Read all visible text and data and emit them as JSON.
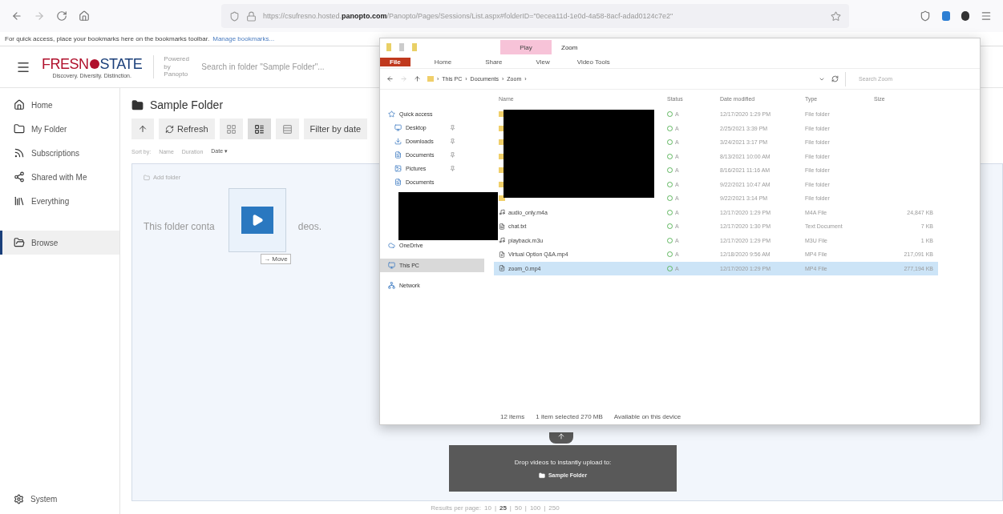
{
  "browser": {
    "url_prefix": "https://csufresno.hosted.",
    "url_domain": "panopto.com",
    "url_path": "/Panopto/Pages/Sessions/List.aspx#folderID=\"0ecea11d-1e0d-4a58-8acf-adad0124c7e2\"",
    "bookmarks_hint": "For quick access, place your bookmarks here on the bookmarks toolbar.",
    "bookmarks_link": "Manage bookmarks..."
  },
  "header": {
    "logo_left": "FRESN",
    "logo_right": "STATE",
    "tagline": "Discovery. Diversity. Distinction.",
    "powered_by": "Powered by Panopto",
    "search_placeholder": "Search in folder \"Sample Folder\"..."
  },
  "sidebar": {
    "items": [
      {
        "label": "Home",
        "kind": "home",
        "selected": false
      },
      {
        "label": "My Folder",
        "kind": "myfolder",
        "selected": false
      },
      {
        "label": "Subscriptions",
        "kind": "subscriptions",
        "selected": false
      },
      {
        "label": "Shared with Me",
        "kind": "shared",
        "selected": false
      },
      {
        "label": "Everything",
        "kind": "everything",
        "selected": false
      },
      {
        "label": "Browse",
        "kind": "browse",
        "selected": true
      }
    ],
    "system": "System"
  },
  "main": {
    "title": "Sample Folder",
    "refresh": "Refresh",
    "views": [
      {
        "kind": "tiles",
        "selected": false
      },
      {
        "kind": "details",
        "selected": true
      },
      {
        "kind": "list",
        "selected": false
      }
    ],
    "filter": "Filter by date",
    "sort_label": "Sort by:",
    "sort_options": [
      {
        "label": "Name",
        "selected": false
      },
      {
        "label": "Duration",
        "selected": false
      },
      {
        "label": "Date ▾",
        "selected": true
      }
    ],
    "add_folder": "Add folder",
    "empty_start": "This folder conta",
    "empty_end": "deos.",
    "drag_label": "→ Move"
  },
  "explorer": {
    "title": "Zoom",
    "context_tab": "Play",
    "context_group": "Video Tools",
    "tabs": [
      {
        "label": "File",
        "kind": "file",
        "selected": true
      },
      {
        "label": "Home",
        "kind": "plain",
        "selected": false
      },
      {
        "label": "Share",
        "kind": "plain",
        "selected": false
      },
      {
        "label": "View",
        "kind": "plain",
        "selected": false
      }
    ],
    "breadcrumb": [
      "This PC",
      "Documents",
      "Zoom"
    ],
    "breadcrumb_separator": "›",
    "search_placeholder": "Search Zoom",
    "nav": [
      {
        "label": "Quick access",
        "kind": "star",
        "pinned": false,
        "selected": false
      },
      {
        "label": "Desktop",
        "kind": "desktop",
        "pinned": true,
        "selected": false
      },
      {
        "label": "Downloads",
        "kind": "download",
        "pinned": true,
        "selected": false
      },
      {
        "label": "Documents",
        "kind": "docs",
        "pinned": true,
        "selected": false
      },
      {
        "label": "Pictures",
        "kind": "pictures",
        "pinned": true,
        "selected": false
      },
      {
        "label": "Documents",
        "kind": "docs",
        "pinned": false,
        "selected": false
      },
      {
        "label": "OneDrive",
        "kind": "cloud",
        "pinned": false,
        "selected": false
      },
      {
        "label": "This PC",
        "kind": "pc",
        "pinned": false,
        "selected": true
      },
      {
        "label": "Network",
        "kind": "network",
        "pinned": false,
        "selected": false
      }
    ],
    "columns": [
      "Name",
      "Status",
      "Date modified",
      "Type",
      "Size"
    ],
    "rows": [
      {
        "kind": "folder",
        "status": "A",
        "date": "12/17/2020 1:29 PM",
        "type": "File folder",
        "selected": false
      },
      {
        "kind": "folder",
        "status": "A",
        "date": "2/25/2021 3:39 PM",
        "type": "File folder",
        "selected": false
      },
      {
        "kind": "folder",
        "status": "A",
        "date": "3/24/2021 3:17 PM",
        "type": "File folder",
        "selected": false
      },
      {
        "kind": "folder",
        "status": "A",
        "date": "8/13/2021 10:00 AM",
        "type": "File folder",
        "selected": false
      },
      {
        "kind": "folder",
        "status": "A",
        "date": "8/16/2021 11:16 AM",
        "type": "File folder",
        "selected": false
      },
      {
        "kind": "folder",
        "status": "A",
        "date": "9/22/2021 10:47 AM",
        "type": "File folder",
        "selected": false
      },
      {
        "kind": "folder",
        "status": "A",
        "date": "9/22/2021 3:14 PM",
        "type": "File folder",
        "selected": false
      },
      {
        "kind": "audio",
        "name": "audio_only.m4a",
        "status": "A",
        "date": "12/17/2020 1:29 PM",
        "type": "M4A File",
        "size": "24,847 KB",
        "selected": false
      },
      {
        "kind": "text",
        "name": "chat.txt",
        "status": "A",
        "date": "12/17/2020 1:30 PM",
        "type": "Text Document",
        "size": "7 KB",
        "selected": false
      },
      {
        "kind": "audio",
        "name": "playback.m3u",
        "status": "A",
        "date": "12/17/2020 1:29 PM",
        "type": "M3U File",
        "size": "1 KB",
        "selected": false
      },
      {
        "kind": "video",
        "name": "Virtual Option Q&A.mp4",
        "status": "A",
        "date": "12/18/2020 9:56 AM",
        "type": "MP4 File",
        "size": "217,091 KB",
        "selected": false
      },
      {
        "kind": "video",
        "name": "zoom_0.mp4",
        "status": "A",
        "date": "12/17/2020 1:29 PM",
        "type": "MP4 File",
        "size": "277,194 KB",
        "selected": true
      }
    ],
    "status": [
      "12 items",
      "1 item selected 270 MB",
      "Available on this device"
    ]
  },
  "upload": {
    "text": "Drop videos to instantly upload to:",
    "folder": "Sample Folder"
  },
  "pagination": {
    "label": "Results per page:",
    "separator": "|",
    "options": [
      {
        "label": "10",
        "selected": false
      },
      {
        "label": "25",
        "selected": true
      },
      {
        "label": "50",
        "selected": false
      },
      {
        "label": "100",
        "selected": false
      },
      {
        "label": "250",
        "selected": false
      }
    ]
  }
}
